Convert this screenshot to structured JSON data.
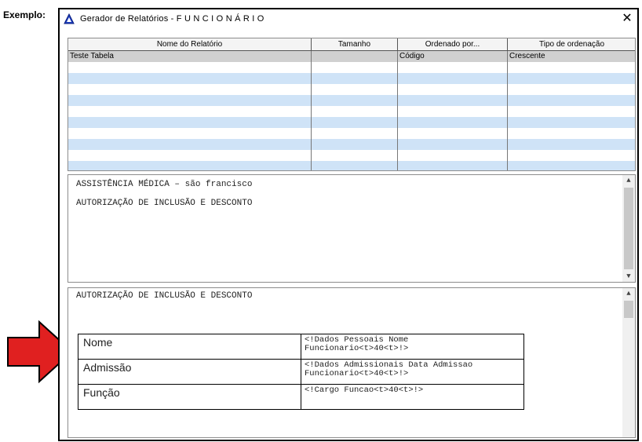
{
  "caption": "Exemplo:",
  "window": {
    "title": "Gerador de Relatórios - F U N C I O N Á R I O",
    "close_glyph": "✕"
  },
  "grid": {
    "columns": [
      "Nome do Relatório",
      "Tamanho",
      "Ordenado por...",
      "Tipo de ordenação"
    ],
    "rows": [
      [
        "Teste Tabela",
        "",
        "Código",
        "Crescente"
      ]
    ]
  },
  "pane1": {
    "lines": [
      "ASSISTÊNCIA MÉDICA – são francisco",
      "AUTORIZAÇÃO DE INCLUSÃO E DESCONTO"
    ]
  },
  "pane2": {
    "heading": "AUTORIZAÇÃO DE INCLUSÃO E DESCONTO",
    "table": [
      {
        "label": "Nome",
        "value_line1": "<!Dados Pessoais Nome",
        "value_line2": "Funcionario<t>40<t>!>"
      },
      {
        "label": "Admissão",
        "value_line1": "<!Dados Admissionais Data Admissao",
        "value_line2": "Funcionario<t>40<t>!>"
      },
      {
        "label": "Função",
        "value_line1": "<!Cargo Funcao<t>40<t>!>",
        "value_line2": ""
      }
    ]
  },
  "scroll": {
    "up_glyph": "▲",
    "down_glyph": "▼"
  },
  "colors": {
    "arrow": "#e02020",
    "row_alt": "#cfe3f7",
    "row_selected": "#d0d0d0"
  },
  "icons": {
    "app": "triangle-app-icon",
    "pointer": "red-arrow-icon"
  }
}
